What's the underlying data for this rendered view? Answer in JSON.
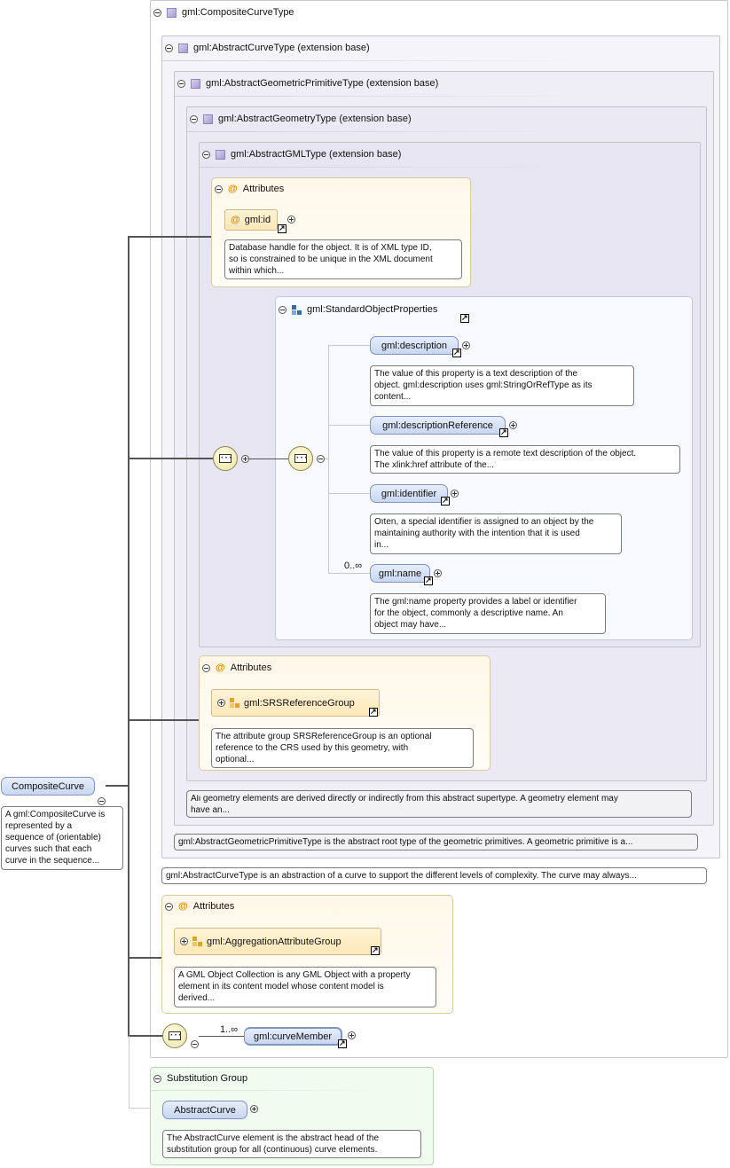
{
  "root": {
    "label": "CompositeCurve",
    "note": "A gml:CompositeCurve is\nrepresented by a\nsequence of (orientable)\ncurves such that each\ncurve in the sequence..."
  },
  "types": {
    "composite": "gml:CompositeCurveType",
    "abstract_curve": "gml:AbstractCurveType (extension base)",
    "abstract_geom_prim": "gml:AbstractGeometricPrimitiveType (extension base)",
    "abstract_geometry": "gml:AbstractGeometryType (extension base)",
    "abstract_gml": "gml:AbstractGMLType (extension base)"
  },
  "gml_attrs": {
    "heading": "Attributes",
    "id_label": "gml:id",
    "id_note": "Database handle for the object. It is of XML type ID,\nso is constrained to be unique in the XML document\nwithin which..."
  },
  "std_props": {
    "label": "gml:StandardObjectProperties",
    "occurs": "0..∞",
    "items": [
      {
        "label": "gml:description",
        "note": "The value of this property is a text description of the\nobject. gml:description uses gml:StringOrRefType as its\ncontent..."
      },
      {
        "label": "gml:descriptionReference",
        "note": "The value of this property is a remote text description of the object.\nThe xlink:href attribute of the..."
      },
      {
        "label": "gml:identifier",
        "note": "Often, a special identifier is assigned to an object by the\nmaintaining authority with the intention that it is used\nin..."
      },
      {
        "label": "gml:name",
        "note": "The gml:name property provides a label or identifier\nfor the object, commonly a descriptive name. An\nobject may have..."
      }
    ]
  },
  "srs_attrs": {
    "heading": "Attributes",
    "group_label": "gml:SRSReferenceGroup",
    "group_note": "The attribute group SRSReferenceGroup is an optional\nreference to the CRS used by this geometry, with\noptional..."
  },
  "notes": {
    "geometry": "All geometry elements are derived directly or indirectly from this abstract supertype. A geometry element may\nhave an...",
    "geom_prim": "gml:AbstractGeometricPrimitiveType is the abstract root type of the geometric primitives. A geometric primitive is a...",
    "curve": "gml:AbstractCurveType is an abstraction of a curve to support the different levels of complexity. The curve may always..."
  },
  "agg_attrs": {
    "heading": "Attributes",
    "group_label": "gml:AggregationAttributeGroup",
    "group_note": "A GML Object Collection is any GML Object with a property\nelement in its content model whose content model is\nderived..."
  },
  "curve_member": {
    "occurs": "1..∞",
    "label": "gml:curveMember"
  },
  "substitution": {
    "heading": "Substitution Group",
    "label": "AbstractCurve",
    "note": "The AbstractCurve element is the abstract head of the\nsubstitution group for all (continuous) curve elements."
  }
}
